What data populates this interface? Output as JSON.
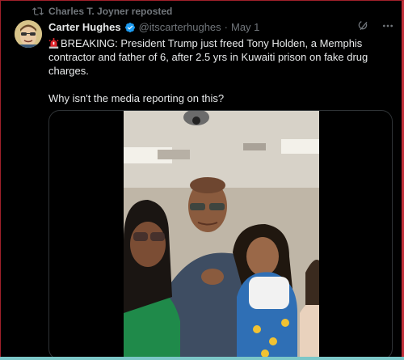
{
  "repost": {
    "label": "Charles T. Joyner reposted"
  },
  "author": {
    "name": "Carter Hughes",
    "handle": "@itscarterhughes",
    "separator": "·",
    "date": "May 1"
  },
  "post": {
    "line1": "BREAKING: President Trump just freed Tony Holden, a Memphis contractor and father of 6, after 2.5 yrs in Kuwaiti prison on fake drug charges.",
    "line2": "Why isn't the media reporting on this?"
  },
  "icons": {
    "repost": "repost-icon",
    "verified": "verified-badge-icon",
    "grok": "grok-icon",
    "more": "more-icon",
    "siren": "siren-emoji-icon"
  },
  "colors": {
    "background": "#000000",
    "text": "#e7e9ea",
    "muted": "#71767b",
    "verified": "#1d9bf0"
  }
}
